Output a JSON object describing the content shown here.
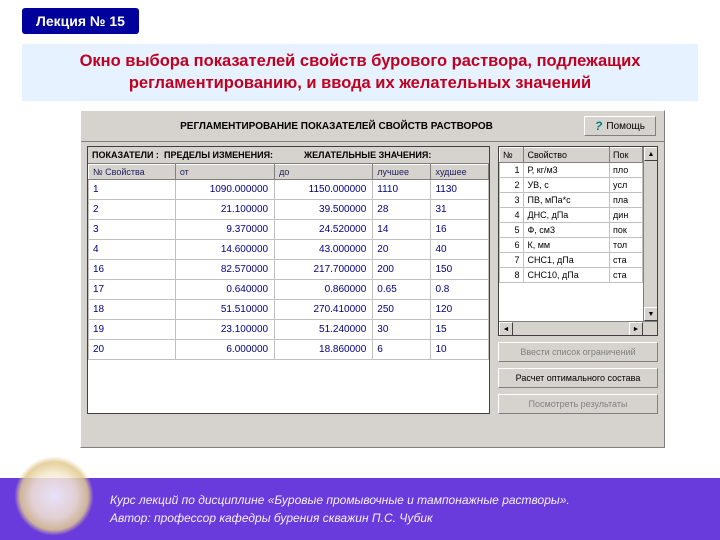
{
  "lecture_badge": "Лекция № 15",
  "page_title": "Окно выбора показателей свойств бурового раствора, подлежащих регламентированию, и ввода их желательных значений",
  "window": {
    "title": "РЕГЛАМЕНТИРОВАНИЕ ПОКАЗАТЕЛЕЙ СВОЙСТВ РАСТВОРОВ",
    "help": "Помощь"
  },
  "left_table": {
    "group_headers": {
      "a": "ПОКАЗАТЕЛИ :",
      "b": "ПРЕДЕЛЫ ИЗМЕНЕНИЯ:",
      "c": "ЖЕЛАТЕЛЬНЫЕ ЗНАЧЕНИЯ:"
    },
    "cols": {
      "c1": "№ Свойства",
      "c2": "от",
      "c3": "до",
      "c4": "лучшее",
      "c5": "худшее"
    },
    "rows": [
      {
        "n": "1",
        "from": "1090.000000",
        "to": "1150.000000",
        "best": "1110",
        "worst": "1130"
      },
      {
        "n": "2",
        "from": "21.100000",
        "to": "39.500000",
        "best": "28",
        "worst": "31"
      },
      {
        "n": "3",
        "from": "9.370000",
        "to": "24.520000",
        "best": "14",
        "worst": "16"
      },
      {
        "n": "4",
        "from": "14.600000",
        "to": "43.000000",
        "best": "20",
        "worst": "40"
      },
      {
        "n": "16",
        "from": "82.570000",
        "to": "217.700000",
        "best": "200",
        "worst": "150"
      },
      {
        "n": "17",
        "from": "0.640000",
        "to": "0.860000",
        "best": "0.65",
        "worst": "0.8"
      },
      {
        "n": "18",
        "from": "51.510000",
        "to": "270.410000",
        "best": "250",
        "worst": "120"
      },
      {
        "n": "19",
        "from": "23.100000",
        "to": "51.240000",
        "best": "30",
        "worst": "15"
      },
      {
        "n": "20",
        "from": "6.000000",
        "to": "18.860000",
        "best": "6",
        "worst": "10"
      }
    ]
  },
  "right_table": {
    "cols": {
      "c1": "№",
      "c2": "Свойство",
      "c3": "Пок"
    },
    "rows": [
      {
        "n": "1",
        "prop": "Р, кг/м3",
        "val": "пло"
      },
      {
        "n": "2",
        "prop": "УВ, с",
        "val": "усл"
      },
      {
        "n": "3",
        "prop": "ПВ, мПа*с",
        "val": "пла"
      },
      {
        "n": "4",
        "prop": "ДНС, дПа",
        "val": "дин"
      },
      {
        "n": "5",
        "prop": "Ф, см3",
        "val": "пок"
      },
      {
        "n": "6",
        "prop": "К, мм",
        "val": "тол"
      },
      {
        "n": "7",
        "prop": "СНС1, дПа",
        "val": "ста"
      },
      {
        "n": "8",
        "prop": "СНС10, дПа",
        "val": "ста"
      }
    ]
  },
  "side_buttons": {
    "b1": "Ввести список ограничений",
    "b2": "Расчет оптимального состава",
    "b3": "Посмотреть результаты"
  },
  "footer": {
    "line1": "Курс лекций по дисциплине «Буровые промывочные и тампонажные растворы».",
    "line2": "Автор: профессор кафедры бурения скважин П.С. Чубик"
  }
}
